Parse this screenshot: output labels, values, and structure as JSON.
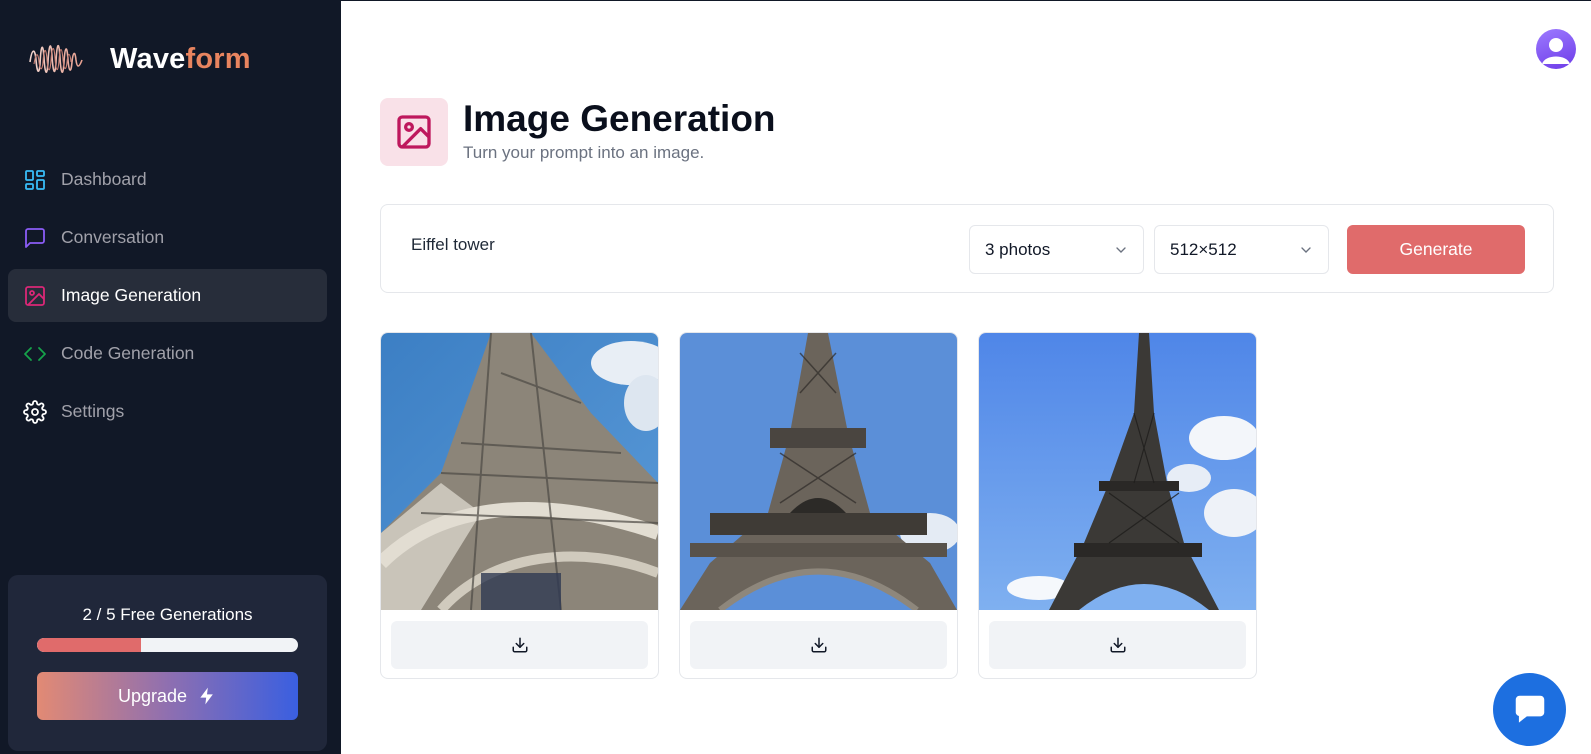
{
  "brand": {
    "name_part1": "Wave",
    "name_part2": "form"
  },
  "nav": {
    "items": [
      {
        "label": "Dashboard",
        "icon": "dashboard-icon",
        "color": "#38bdf8",
        "active": false
      },
      {
        "label": "Conversation",
        "icon": "message-square-icon",
        "color": "#8b5cf6",
        "active": false
      },
      {
        "label": "Image Generation",
        "icon": "image-icon",
        "color": "#db2777",
        "active": true
      },
      {
        "label": "Code Generation",
        "icon": "code-icon",
        "color": "#16a34a",
        "active": false
      },
      {
        "label": "Settings",
        "icon": "gear-icon",
        "color": "#ffffff",
        "active": false
      }
    ]
  },
  "usage": {
    "text": "2 / 5 Free Generations",
    "used": 2,
    "limit": 5,
    "upgrade_label": "Upgrade"
  },
  "header": {
    "title": "Image Generation",
    "subtitle": "Turn your prompt into an image.",
    "icon": "image-icon",
    "icon_color": "#be185d",
    "icon_bg": "#f9e1e8"
  },
  "form": {
    "prompt_value": "Eiffel tower",
    "amount_selected": "3 photos",
    "resolution_selected": "512×512",
    "generate_label": "Generate"
  },
  "results": [
    {
      "alt": "Eiffel tower",
      "action_icon": "download-icon"
    },
    {
      "alt": "Eiffel tower",
      "action_icon": "download-icon"
    },
    {
      "alt": "Eiffel tower",
      "action_icon": "download-icon"
    }
  ],
  "colors": {
    "sidebar_bg": "#111827",
    "accent": "#e06b6b",
    "chat_button": "#1d6fe0"
  }
}
